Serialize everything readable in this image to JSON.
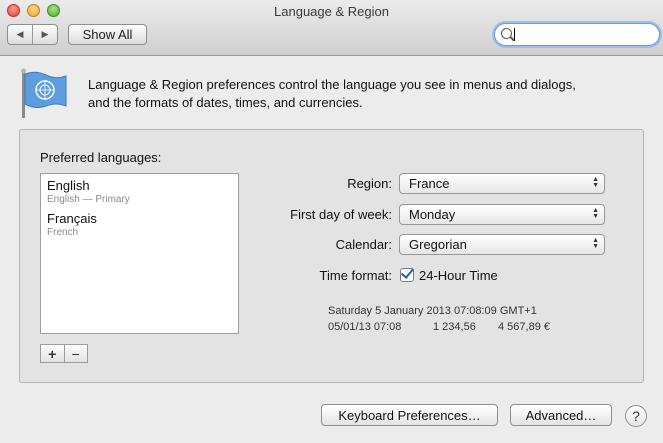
{
  "window": {
    "title": "Language & Region"
  },
  "toolbar": {
    "back": "◀",
    "forward": "▶",
    "show_all": "Show All",
    "search_value": ""
  },
  "description": {
    "line1": "Language & Region preferences control the language you see in menus and dialogs,",
    "line2": "and the formats of dates, times, and currencies."
  },
  "languages": {
    "label": "Preferred languages:",
    "items": [
      {
        "name": "English",
        "sub": "English — Primary"
      },
      {
        "name": "Français",
        "sub": "French"
      }
    ],
    "add": "+",
    "remove": "−"
  },
  "settings": {
    "region_label": "Region:",
    "region_value": "France",
    "first_day_label": "First day of week:",
    "first_day_value": "Monday",
    "calendar_label": "Calendar:",
    "calendar_value": "Gregorian",
    "time_format_label": "Time format:",
    "time_format_option": "24-Hour Time",
    "time_format_checked": true
  },
  "sample": {
    "line1": "Saturday 5 January 2013 07:08:09 GMT+1",
    "short_date": "05/01/13 07:08",
    "number": "1 234,56",
    "currency": "4 567,89 €"
  },
  "buttons": {
    "keyboard": "Keyboard Preferences…",
    "advanced": "Advanced…",
    "help": "?"
  }
}
